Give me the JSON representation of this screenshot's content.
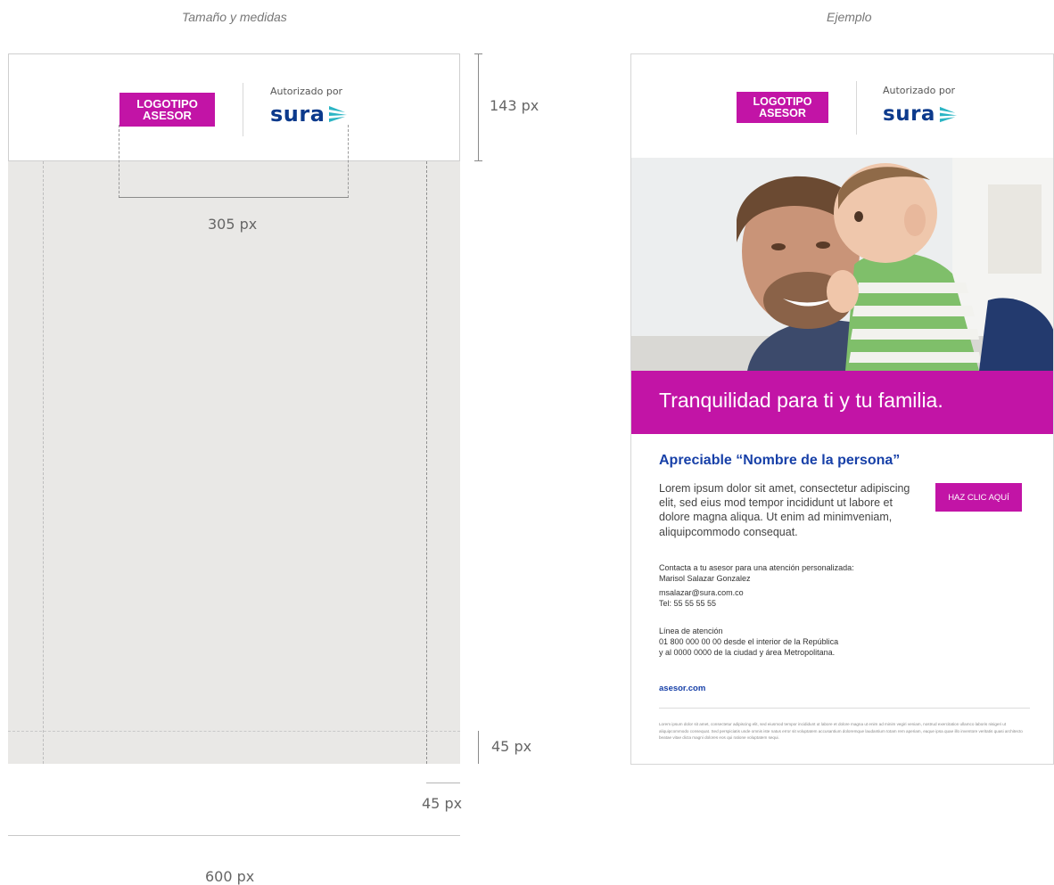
{
  "captions": {
    "left": "Tamaño y medidas",
    "right": "Ejemplo"
  },
  "brand": {
    "logo_line1": "LOGOTIPO",
    "logo_line2": "ASESOR",
    "authorized_by": "Autorizado por",
    "sura_wordmark": "sura",
    "magenta": "#c214a6",
    "navy": "#0c3a8c",
    "teal": "#2bb5c4"
  },
  "measurements": {
    "header_height": "143 px",
    "logo_span_width": "305 px",
    "bottom_margin": "45 px",
    "side_margin": "45 px",
    "total_width": "600 px"
  },
  "example": {
    "banner_title": "Tranquilidad para ti y tu familia.",
    "greeting": "Apreciable “Nombre de la persona”",
    "body": "Lorem ipsum dolor sit amet, consectetur adipiscing elit, sed eius mod tempor incididunt ut labore et dolore magna aliqua. Ut enim ad minimveniam, aliquipcommodo consequat.",
    "cta_label": "HAZ CLIC AQUÍ",
    "contact_intro": "Contacta a tu asesor para una atención personalizada:",
    "contact_name": "Marisol Salazar Gonzalez",
    "contact_email": "msalazar@sura.com.co",
    "contact_phone": "Tel: 55 55 55 55",
    "line_title": "Línea de atención",
    "line_1": "01 800 000 00 00 desde el interior de la República",
    "line_2": "y al 0000 0000 de la ciudad y área Metropolitana.",
    "website": "asesor.com",
    "legal": "Lorem ipsum dolor sit amet, consectetur adipiscing elit, sed eiusmod tempor incididunt ut labore et dolore magna ut enim ad minim vegiri veniam, nostrud exercitation ullamco laboris nisigeri ut aliquipcommodo consequat. Sed perspiciatis unde omnis iste natus error sit voluptatem accusantium doloremque laudantium totam rem aperiam, eaque ipsa quae illo inventore veritatis quasi architecto beatae vitae dicta magni dolores eos qui ratione voluptatem sequi."
  }
}
